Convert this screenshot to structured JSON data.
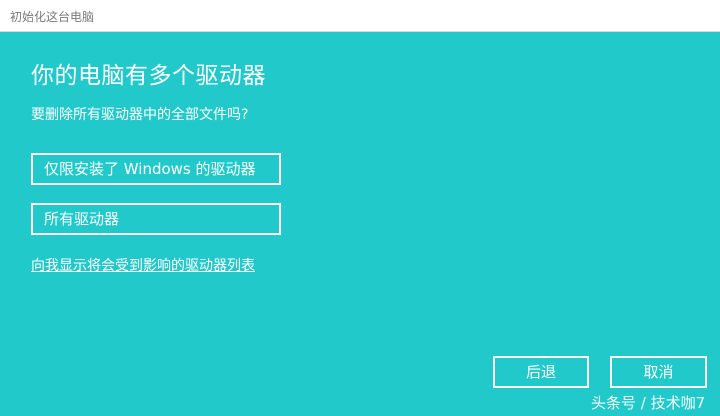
{
  "window": {
    "title": "初始化这台电脑"
  },
  "main": {
    "heading": "你的电脑有多个驱动器",
    "question": "要删除所有驱动器中的全部文件吗?",
    "options": [
      {
        "label": "仅限安装了 Windows 的驱动器"
      },
      {
        "label": "所有驱动器"
      }
    ],
    "affected_link": "向我显示将会受到影响的驱动器列表"
  },
  "footer": {
    "back_label": "后退",
    "cancel_label": "取消"
  },
  "watermark": "头条号 / 技术咖7",
  "colors": {
    "background": "#22c9cb",
    "titlebar": "#ffffff",
    "text": "#ffffff"
  }
}
